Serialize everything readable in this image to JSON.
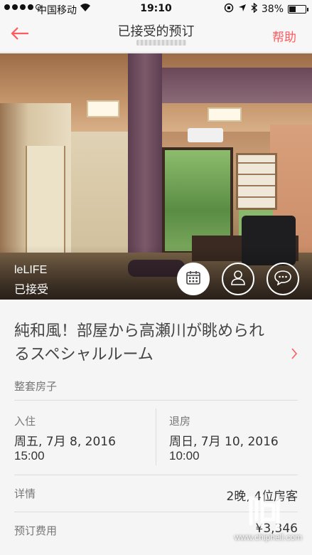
{
  "status_bar": {
    "carrier": "中国移动",
    "time": "19:10",
    "battery": "38%"
  },
  "nav": {
    "back_icon": "arrow-left-icon",
    "title": "已接受的预订",
    "help": "帮助"
  },
  "hero": {
    "host_name": "leLIFE",
    "status": "已接受",
    "buttons": [
      "calendar-icon",
      "user-icon",
      "chat-icon"
    ]
  },
  "listing": {
    "title": "純和風！部屋から高瀬川が眺められるスペシャルルーム",
    "room_type": "整套房子"
  },
  "checkin": {
    "label": "入住",
    "date": "周五, 7月 8, 2016",
    "time": "15:00"
  },
  "checkout": {
    "label": "退房",
    "date": "周日, 7月 10, 2016",
    "time": "10:00"
  },
  "details": {
    "label": "详情",
    "value": "2晚, 4位房客"
  },
  "fee": {
    "label": "预订费用",
    "value": "¥3,346"
  },
  "watermark": "www.chiphell.com",
  "colors": {
    "accent": "#ff5a5f",
    "background": "#f5f5f5"
  }
}
